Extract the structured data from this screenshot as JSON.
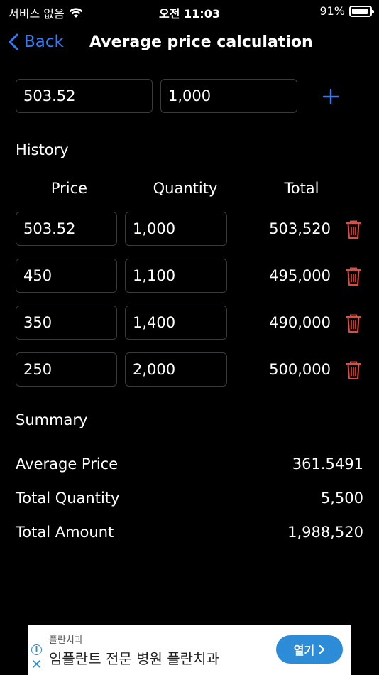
{
  "status_bar": {
    "carrier": "서비스 없음",
    "time": "오전 11:03",
    "battery": "91%",
    "battery_level": 0.91
  },
  "nav": {
    "back_label": "Back",
    "title": "Average price calculation"
  },
  "entry": {
    "price": "503.52",
    "quantity": "1,000",
    "add_icon": "plus-icon"
  },
  "history": {
    "heading": "History",
    "columns": [
      "Price",
      "Quantity",
      "Total"
    ],
    "rows": [
      {
        "price": "503.52",
        "quantity": "1,000",
        "total": "503,520"
      },
      {
        "price": "450",
        "quantity": "1,100",
        "total": "495,000"
      },
      {
        "price": "350",
        "quantity": "1,400",
        "total": "490,000"
      },
      {
        "price": "250",
        "quantity": "2,000",
        "total": "500,000"
      }
    ],
    "delete_icon": "trash-icon",
    "delete_color": "#e5483d"
  },
  "summary": {
    "heading": "Summary",
    "average_price_label": "Average Price",
    "average_price": "361.5491",
    "total_quantity_label": "Total Quantity",
    "total_quantity": "5,500",
    "total_amount_label": "Total Amount",
    "total_amount": "1,988,520"
  },
  "ad": {
    "sponsor": "플란치과",
    "headline": "임플란트 전문 병원 플란치과",
    "cta": "열기",
    "cta_color": "#2d8cd8"
  },
  "colors": {
    "accent": "#2f7cf6",
    "background": "#000000",
    "field_border": "#3a3a3c"
  }
}
